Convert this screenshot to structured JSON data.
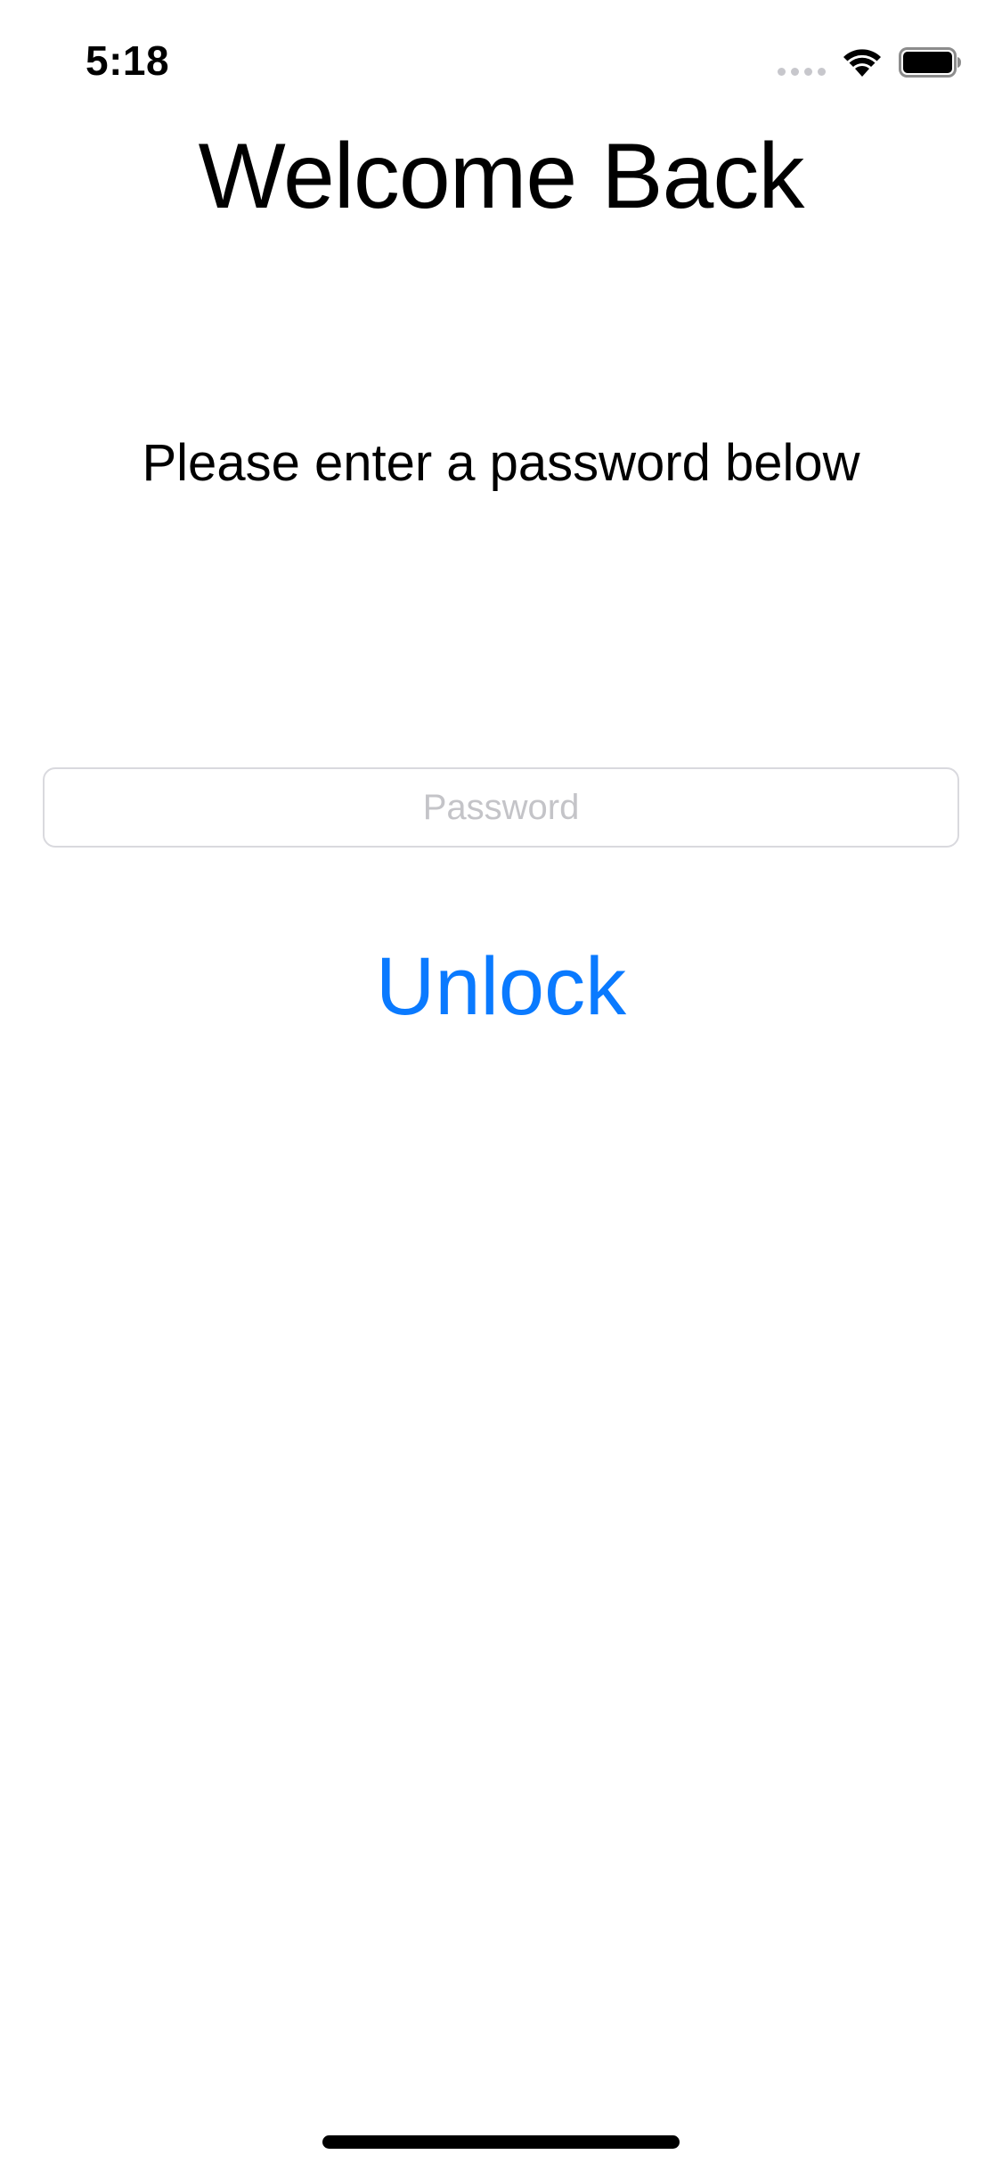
{
  "status_bar": {
    "time": "5:18",
    "icons": [
      "cellular-signal-icon",
      "wifi-icon",
      "battery-icon"
    ]
  },
  "screen": {
    "title": "Welcome Back",
    "subtitle": "Please enter a password below"
  },
  "password_field": {
    "placeholder": "Password",
    "value": ""
  },
  "unlock_button": {
    "label": "Unlock"
  },
  "colors": {
    "accent": "#0a7aff",
    "placeholder": "#c4c4c8",
    "field_border": "#d9d9de",
    "text": "#000000",
    "background": "#ffffff"
  }
}
